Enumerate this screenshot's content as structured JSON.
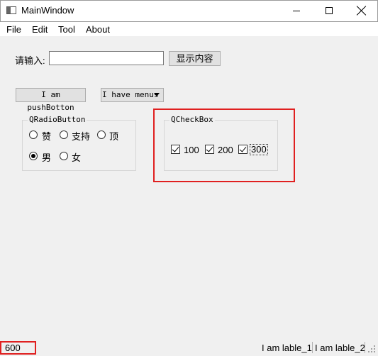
{
  "window": {
    "title": "MainWindow"
  },
  "menu": [
    "File",
    "Edit",
    "Tool",
    "About"
  ],
  "input_row": {
    "label": "请输入:",
    "value": "",
    "button": "显示内容"
  },
  "buttons": {
    "push": "I am pushBotton",
    "menus": "I have menus"
  },
  "radio_group": {
    "title": "QRadioButton",
    "options": [
      {
        "label": "赞",
        "checked": false
      },
      {
        "label": "支持",
        "checked": false
      },
      {
        "label": "顶",
        "checked": false
      },
      {
        "label": "男",
        "checked": true
      },
      {
        "label": "女",
        "checked": false
      }
    ]
  },
  "checkbox_group": {
    "title": "QCheckBox",
    "options": [
      {
        "label": "100",
        "checked": true
      },
      {
        "label": "200",
        "checked": true
      },
      {
        "label": "300",
        "checked": true
      }
    ]
  },
  "status": {
    "left": "600",
    "label1": "I am lable_1",
    "label2": "I am lable_2"
  },
  "colors": {
    "highlight": "#e02020",
    "background": "#f0f0f0"
  }
}
